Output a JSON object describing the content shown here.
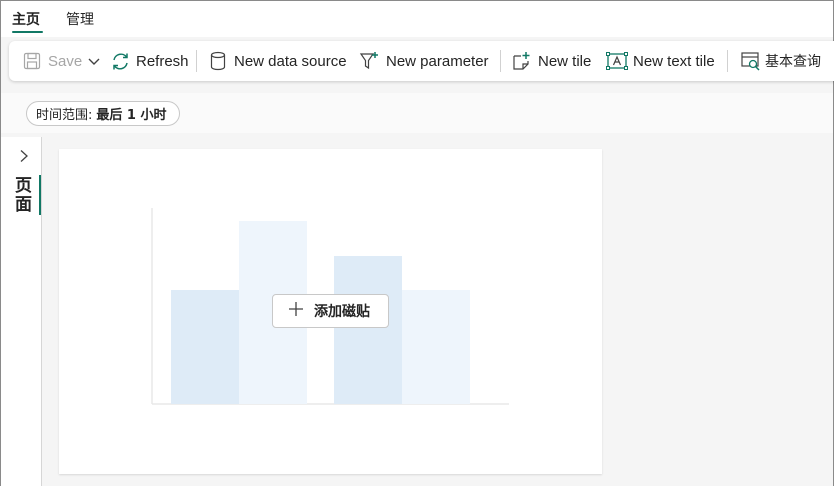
{
  "tabs": [
    {
      "label": "主页",
      "active": true
    },
    {
      "label": "管理",
      "active": false
    }
  ],
  "toolbar": {
    "save_label": "Save",
    "refresh_label": "Refresh",
    "new_data_source_label": "New data source",
    "new_parameter_label": "New parameter",
    "new_tile_label": "New tile",
    "new_text_tile_label": "New text tile",
    "basic_query_label": "基本查询"
  },
  "filter": {
    "label": "时间范围:",
    "value": "最后 1 小时"
  },
  "pages_panel": {
    "label": "页面"
  },
  "canvas": {
    "add_tile_label": "添加磁贴"
  },
  "colors": {
    "accent": "#117865",
    "placeholder_bar_dark": "#deebf7",
    "placeholder_bar_light": "#eef5fc"
  }
}
